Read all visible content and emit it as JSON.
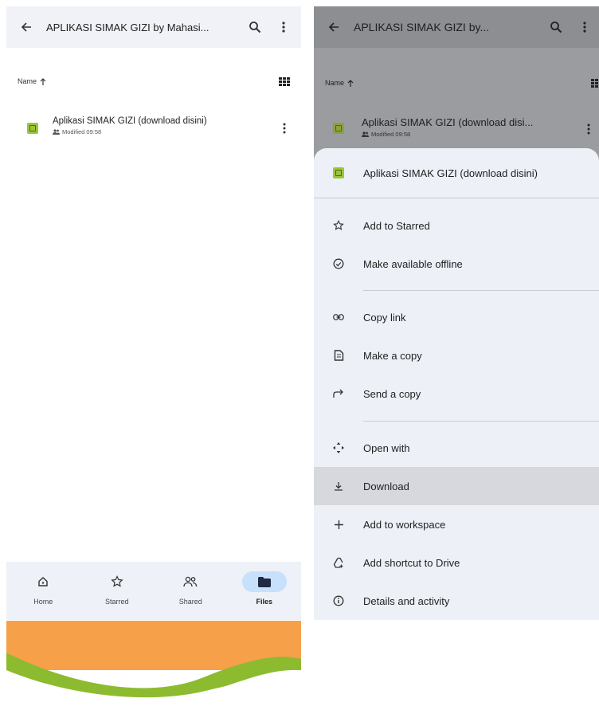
{
  "left": {
    "topbar": {
      "title": "APLIKASI SIMAK GIZI by Mahasi..."
    },
    "sort": {
      "label": "Name"
    },
    "file": {
      "name": "Aplikasi SIMAK GIZI (download disini)",
      "meta": "Modified 09:58"
    },
    "nav": [
      {
        "label": "Home",
        "icon": "home-icon"
      },
      {
        "label": "Starred",
        "icon": "star-icon"
      },
      {
        "label": "Shared",
        "icon": "shared-icon"
      },
      {
        "label": "Files",
        "icon": "folder-icon",
        "active": true
      }
    ]
  },
  "right": {
    "topbar": {
      "title": "APLIKASI SIMAK GIZI by..."
    },
    "sort": {
      "label": "Name"
    },
    "file": {
      "name": "Aplikasi SIMAK GIZI (download disi...",
      "meta": "Modified 09:58"
    },
    "sheet": {
      "title": "Aplikasi SIMAK GIZI (download disini)",
      "items": [
        {
          "label": "Add to Starred",
          "icon": "star-icon"
        },
        {
          "label": "Make available offline",
          "icon": "offline-icon"
        },
        {
          "label": "Copy link",
          "icon": "link-icon"
        },
        {
          "label": "Make a copy",
          "icon": "copy-icon"
        },
        {
          "label": "Send a copy",
          "icon": "send-icon"
        },
        {
          "label": "Open with",
          "icon": "open-with-icon"
        },
        {
          "label": "Download",
          "icon": "download-icon",
          "highlighted": true
        },
        {
          "label": "Add to workspace",
          "icon": "plus-icon"
        },
        {
          "label": "Add shortcut to Drive",
          "icon": "shortcut-icon"
        },
        {
          "label": "Details and activity",
          "icon": "info-icon"
        }
      ]
    }
  },
  "colors": {
    "appbar": "#f0f2f8",
    "sheet": "#eef0f8",
    "active_nav": "#c7e0fb",
    "file_icon": "#9bc43c",
    "banner_orange": "#f6a04a",
    "banner_green": "#8dbb2f"
  }
}
